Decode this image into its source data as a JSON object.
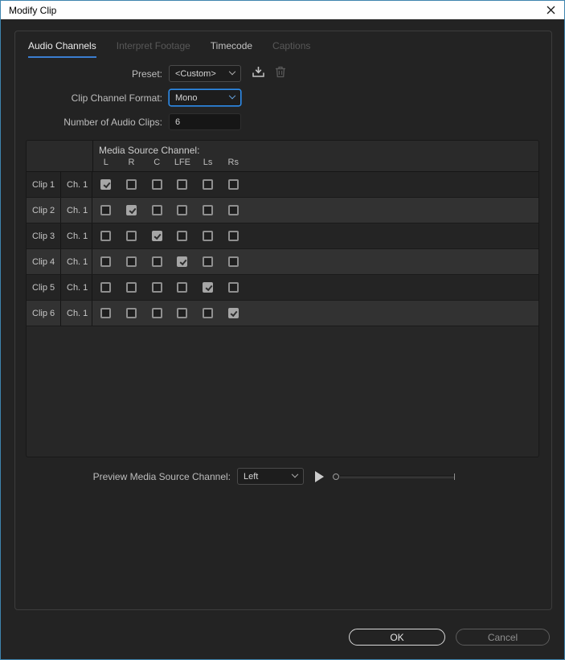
{
  "window": {
    "title": "Modify Clip"
  },
  "icons": {
    "close": "x-cross",
    "save_preset": "save-preset-tray-arrow",
    "delete_preset": "trash-can",
    "dropdown": "chevron-down",
    "play": "play-triangle"
  },
  "colors": {
    "window_border": "#3e84ae",
    "tab_underline": "#3b7ed0",
    "focus_blue": "#2d8ceb",
    "titlebar_bg": "#ffffff",
    "dialog_bg": "#232323"
  },
  "tabs": [
    {
      "label": "Audio Channels",
      "state": "active"
    },
    {
      "label": "Interpret Footage",
      "state": "disabled"
    },
    {
      "label": "Timecode",
      "state": "normal"
    },
    {
      "label": "Captions",
      "state": "disabled"
    }
  ],
  "form": {
    "preset_label": "Preset:",
    "preset_value": "<Custom>",
    "format_label": "Clip Channel Format:",
    "format_value": "Mono",
    "clips_label": "Number of Audio Clips:",
    "clips_value": "6"
  },
  "channel_table": {
    "title": "Media Source Channel:",
    "columns": [
      "L",
      "R",
      "C",
      "LFE",
      "Ls",
      "Rs"
    ],
    "rows": [
      {
        "clip": "Clip 1",
        "channel": "Ch. 1",
        "checks": [
          true,
          false,
          false,
          false,
          false,
          false
        ]
      },
      {
        "clip": "Clip 2",
        "channel": "Ch. 1",
        "checks": [
          false,
          true,
          false,
          false,
          false,
          false
        ]
      },
      {
        "clip": "Clip 3",
        "channel": "Ch. 1",
        "checks": [
          false,
          false,
          true,
          false,
          false,
          false
        ]
      },
      {
        "clip": "Clip 4",
        "channel": "Ch. 1",
        "checks": [
          false,
          false,
          false,
          true,
          false,
          false
        ]
      },
      {
        "clip": "Clip 5",
        "channel": "Ch. 1",
        "checks": [
          false,
          false,
          false,
          false,
          true,
          false
        ]
      },
      {
        "clip": "Clip 6",
        "channel": "Ch. 1",
        "checks": [
          false,
          false,
          false,
          false,
          false,
          true
        ]
      }
    ]
  },
  "preview": {
    "label": "Preview Media Source Channel:",
    "value": "Left",
    "slider_position": 0
  },
  "footer": {
    "ok_label": "OK",
    "cancel_label": "Cancel"
  }
}
